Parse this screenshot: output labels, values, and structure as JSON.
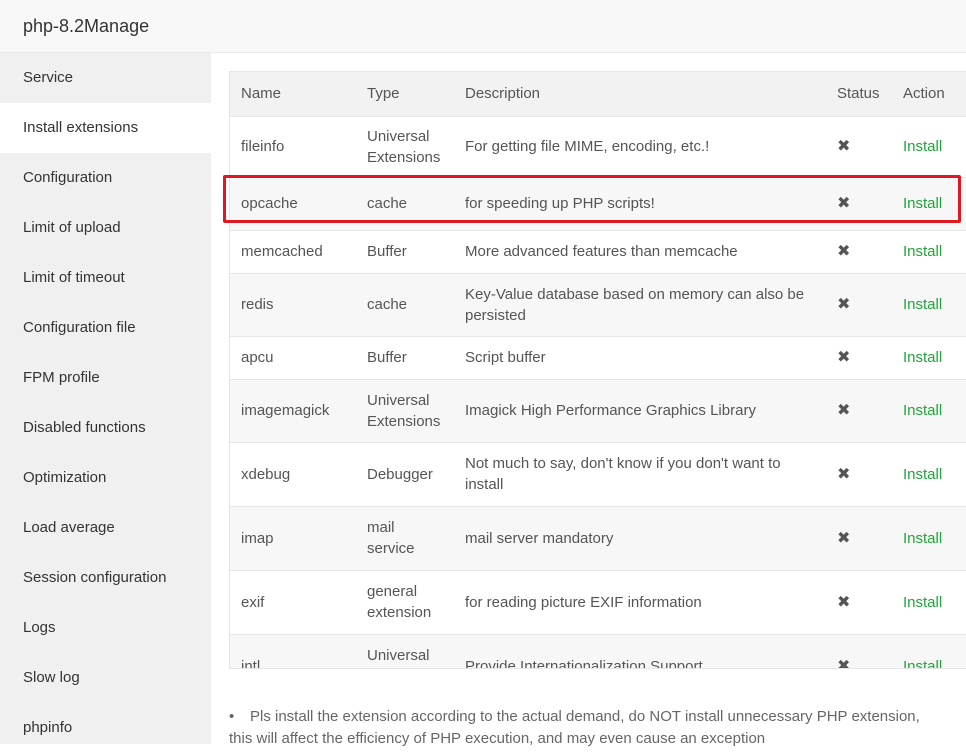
{
  "window": {
    "title": "php-8.2Manage"
  },
  "sidebar": {
    "items": [
      {
        "label": "Service",
        "active": false
      },
      {
        "label": "Install extensions",
        "active": true
      },
      {
        "label": "Configuration",
        "active": false
      },
      {
        "label": "Limit of upload",
        "active": false
      },
      {
        "label": "Limit of timeout",
        "active": false
      },
      {
        "label": "Configuration file",
        "active": false
      },
      {
        "label": "FPM profile",
        "active": false
      },
      {
        "label": "Disabled functions",
        "active": false
      },
      {
        "label": "Optimization",
        "active": false
      },
      {
        "label": "Load average",
        "active": false
      },
      {
        "label": "Session configuration",
        "active": false
      },
      {
        "label": "Logs",
        "active": false
      },
      {
        "label": "Slow log",
        "active": false
      },
      {
        "label": "phpinfo",
        "active": false
      }
    ]
  },
  "table": {
    "headers": {
      "name": "Name",
      "type": "Type",
      "description": "Description",
      "status": "Status",
      "action": "Action"
    },
    "status_icon": "✖",
    "rows": [
      {
        "name": "fileinfo",
        "type": "Universal Extensions",
        "description": "For getting file MIME, encoding, etc.!",
        "action": "Install"
      },
      {
        "name": "opcache",
        "type": "cache",
        "description": "for speeding up PHP scripts!",
        "action": "Install"
      },
      {
        "name": "memcached",
        "type": "Buffer",
        "description": "More advanced features than memcache",
        "action": "Install"
      },
      {
        "name": "redis",
        "type": "cache",
        "description": "Key-Value database based on memory can also be persisted",
        "action": "Install"
      },
      {
        "name": "apcu",
        "type": "Buffer",
        "description": "Script buffer",
        "action": "Install"
      },
      {
        "name": "imagemagick",
        "type": "Universal Extensions",
        "description": "Imagick High Performance Graphics Library",
        "action": "Install"
      },
      {
        "name": "xdebug",
        "type": "Debugger",
        "description": "Not much to say, don't know if you don't want to install",
        "action": "Install"
      },
      {
        "name": "imap",
        "type": "mail service",
        "description": "mail server mandatory",
        "action": "Install"
      },
      {
        "name": "exif",
        "type": "general extension",
        "description": "for reading picture EXIF information",
        "action": "Install"
      },
      {
        "name": "intl",
        "type": "Universal Extensions",
        "description": "Provide Internationalization Support",
        "action": "Install"
      }
    ]
  },
  "notes": [
    "Pls install the extension according to the actual demand, do NOT install unnecessary PHP extension,",
    "this will affect the efficiency of PHP execution, and may even cause an exception"
  ],
  "colors": {
    "install_link": "#20a53a",
    "highlight": "#e0181f",
    "sidebar_bg": "#f0f0f0"
  }
}
